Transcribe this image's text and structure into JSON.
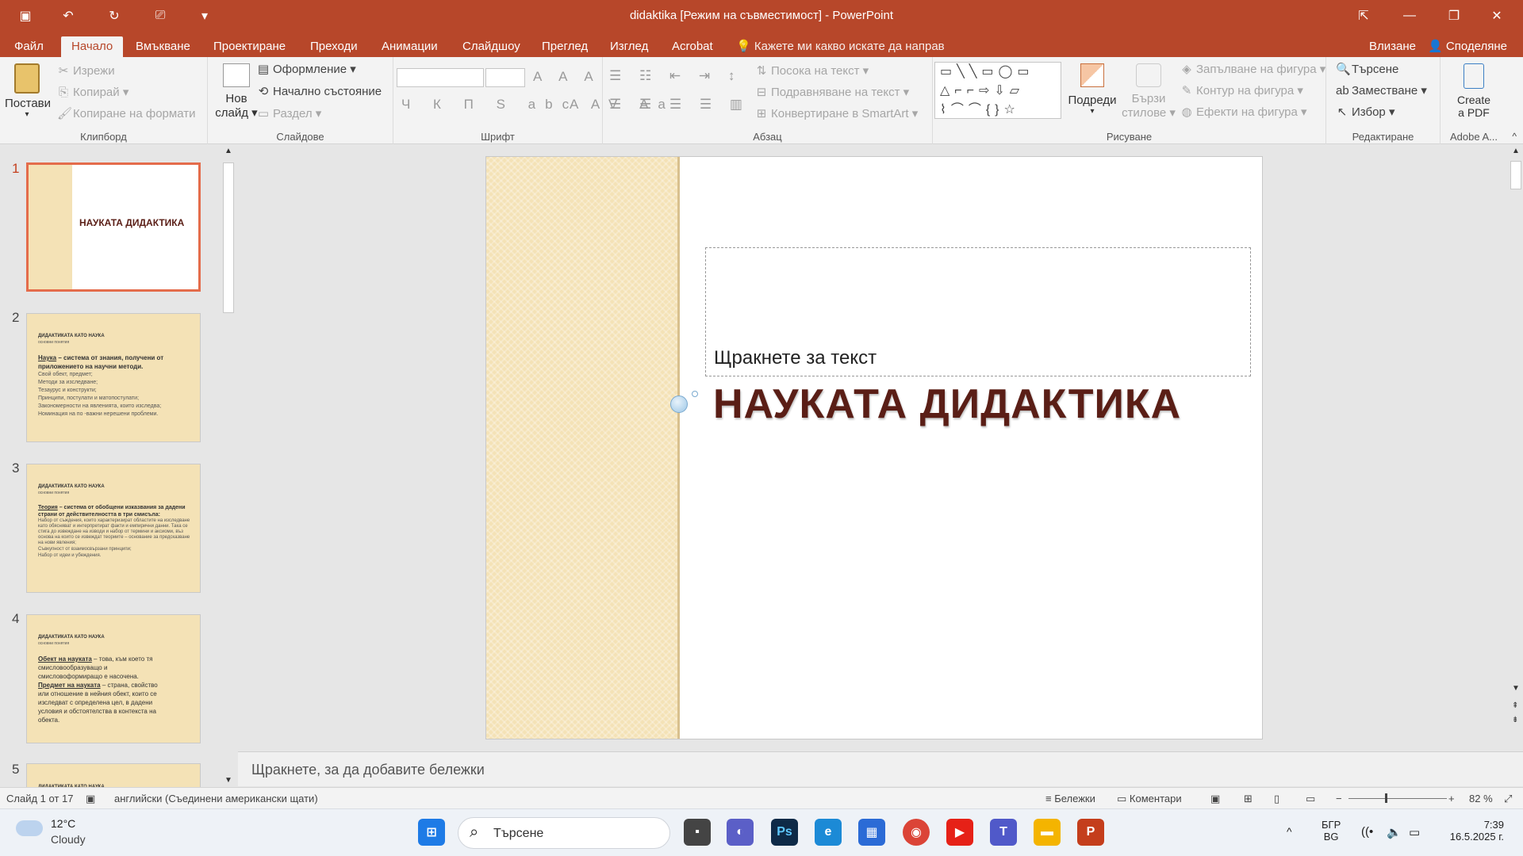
{
  "window": {
    "title": "didaktika [Режим на съвместимост] - PowerPoint",
    "controls": {
      "minimize": "—",
      "restore": "❐",
      "close": "✕"
    }
  },
  "menu": {
    "tabs": [
      "Файл",
      "Начало",
      "Вмъкване",
      "Проектиране",
      "Преходи",
      "Анимации",
      "Слайдшоу",
      "Преглед",
      "Изглед",
      "Acrobat"
    ],
    "active": "Начало",
    "tell_me": "Кажете ми какво искате да направ",
    "sign_in": "Влизане",
    "share": "Споделяне"
  },
  "ribbon": {
    "clipboard": {
      "label": "Клипборд",
      "paste": "Постави",
      "cut": "Изрежи",
      "copy": "Копирай",
      "format_painter": "Копиране на формати"
    },
    "slides": {
      "label": "Слайдове",
      "new_slide_1": "Нов",
      "new_slide_2": "слайд",
      "layout": "Оформление",
      "reset": "Начално състояние",
      "section": "Раздел"
    },
    "font": {
      "label": "Шрифт"
    },
    "paragraph": {
      "label": "Абзац",
      "text_direction": "Посока на текст",
      "align_text": "Подравняване на текст",
      "smartart": "Конвертиране в SmartArt"
    },
    "drawing": {
      "label": "Рисуване",
      "arrange": "Подреди",
      "quick_styles_1": "Бързи",
      "quick_styles_2": "стилове",
      "shape_fill": "Запълване на фигура",
      "shape_outline": "Контур на фигура",
      "shape_effects": "Ефекти на фигура"
    },
    "editing": {
      "label": "Редактиране",
      "find": "Търсене",
      "replace": "Заместване",
      "select": "Избор"
    },
    "adobe": {
      "label": "Adobe A...",
      "create_1": "Create",
      "create_2": "a PDF"
    }
  },
  "thumbnails": [
    {
      "num": "1",
      "title": "НАУКАТА ДИДАКТИКА"
    },
    {
      "num": "2",
      "h": "ДИДАКТИКАТА КАТО НАУКА",
      "h2": "основни понятия",
      "lead_u": "Наука",
      "lead": " – система от знания, получени от приложението на научни методи.",
      "items": [
        "Свой обект, предмет;",
        "Методи за изследване;",
        "Тезаурус и конструкти;",
        "Принципи, постулати и матопостулати;",
        "Закономерности на явленията, които изследва;",
        "Номинация на по -важни нерешени проблеми."
      ]
    },
    {
      "num": "3",
      "h": "ДИДАКТИКАТА КАТО НАУКА",
      "h2": "основни понятия",
      "lead_u": "Теория",
      "lead": " – система от обобщени изказвания за дадени страни от действителността в три смисъла:",
      "items": [
        "Набор от съждения, които характеризират областите на изследване като обясняват и интерпретират факти и емпирични данни. Така се стига до извеждане на изводи и набор от термини и аксиоми, въз основа на които се извеждат теориите – основание за предсказване на нови явления;",
        "Съвкупност от взаимосвързани принципи;",
        "Набор от идеи и убеждения."
      ]
    },
    {
      "num": "4",
      "h": "ДИДАКТИКАТА КАТО НАУКА",
      "h2": "основни понятия",
      "lead_u": "Обект на науката",
      "lead": " – това, към което тя смисловообразуващо и смисловоформиращо е насочена.",
      "lead2_u": "Предмет на науката",
      "lead2": " – страна, свойство или отношение в нейния обект, които се изследват с определена цел, в дадени условия и обстоятелства в контекста на обекта."
    },
    {
      "num": "5",
      "h": "ДИДАКТИКАТА КАТО НАУКА"
    }
  ],
  "slide": {
    "placeholder": "Щракнете за текст",
    "title": "НАУКАТА ДИДАКТИКА"
  },
  "notes": {
    "placeholder": "Щракнете, за да добавите бележки"
  },
  "status": {
    "slide_of": "Слайд 1 от 17",
    "language": "английски (Съединени американски щати)",
    "notes": "Бележки",
    "comments": "Коментари",
    "zoom": "82 %"
  },
  "taskbar": {
    "weather_temp": "12°C",
    "weather_cond": "Cloudy",
    "search": "Търсене",
    "lang1": "БГР",
    "lang2": "BG",
    "time": "7:39",
    "date": "16.5.2025 г."
  },
  "colors": {
    "accent": "#b7472a",
    "slide_side": "#f4e2b6",
    "title_color": "#5a1e16"
  }
}
